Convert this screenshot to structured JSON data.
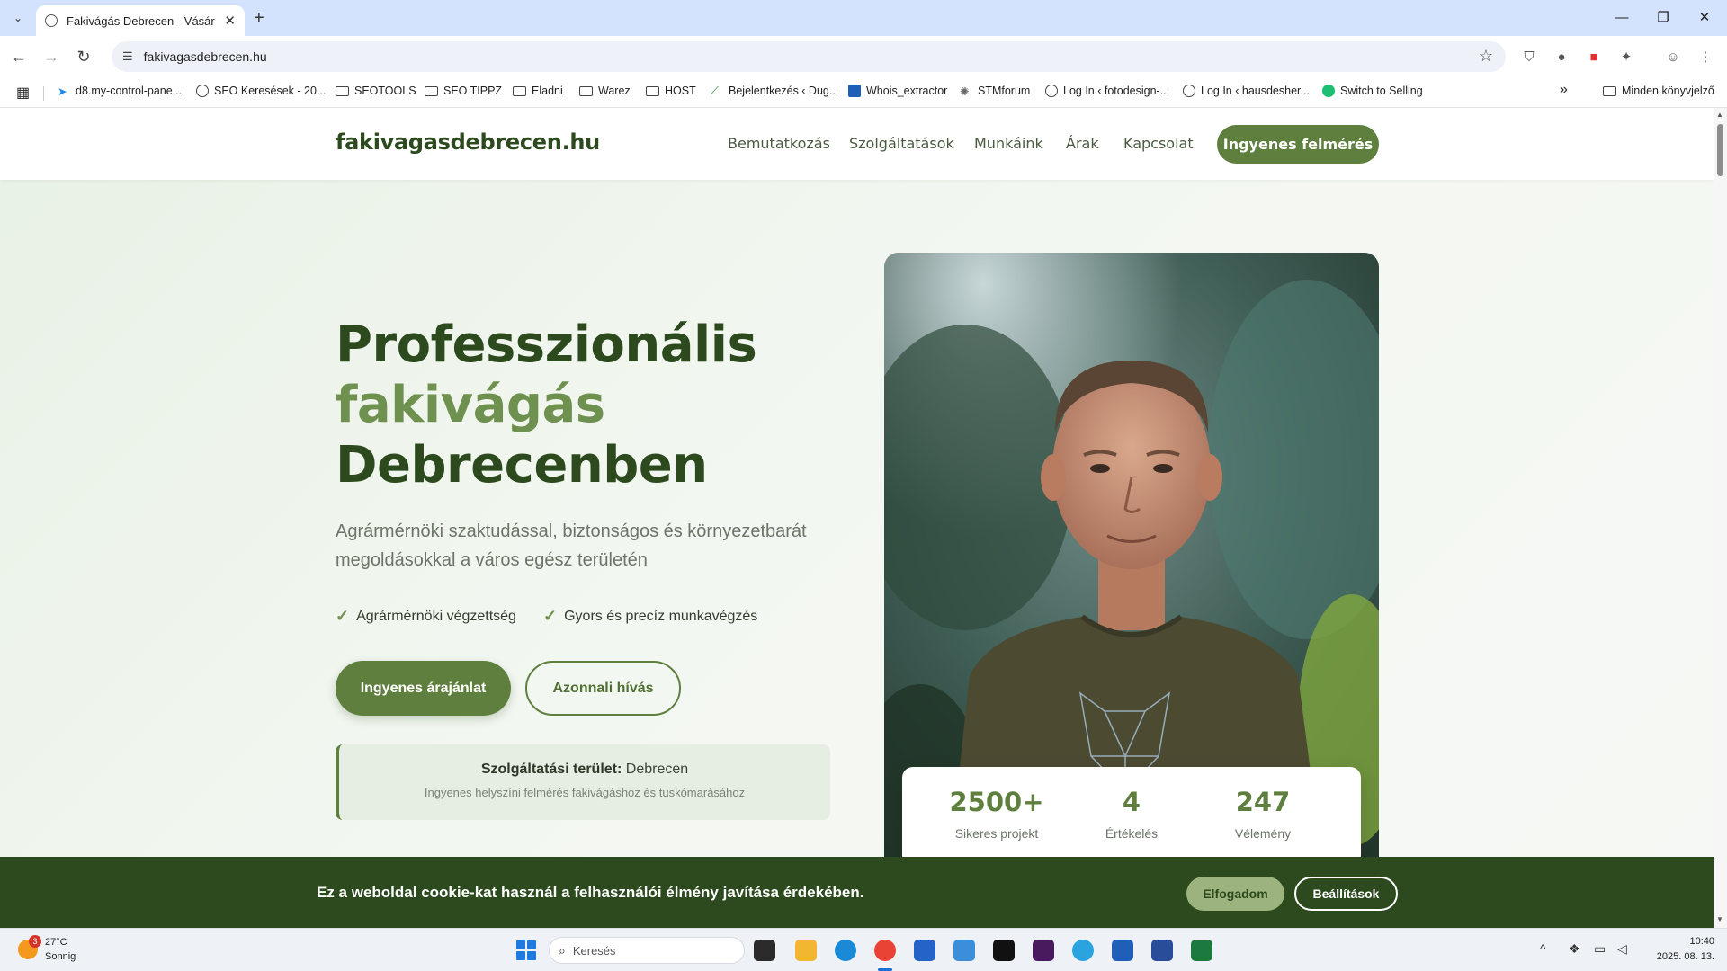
{
  "browser": {
    "tab_title": "Fakivágás Debrecen - Vásári Fe",
    "new_tab_symbol": "+",
    "url": "fakivagasdebrecen.hu",
    "bookmarks": [
      {
        "label": "d8.my-control-pane...",
        "icon": "kinsta-icon"
      },
      {
        "label": "SEO Keresések - 20...",
        "icon": "globe-icon"
      },
      {
        "label": "SEOTOOLS",
        "icon": "folder-icon"
      },
      {
        "label": "SEO TIPPZ",
        "icon": "folder-icon"
      },
      {
        "label": "Eladni",
        "icon": "folder-icon"
      },
      {
        "label": "Warez",
        "icon": "folder-icon"
      },
      {
        "label": "HOST",
        "icon": "folder-icon"
      },
      {
        "label": "Bejelentkezés ‹ Dug...",
        "icon": "site-icon"
      },
      {
        "label": "Whois_extractor",
        "icon": "word-icon"
      },
      {
        "label": "STMforum",
        "icon": "forum-icon"
      },
      {
        "label": "Log In ‹ fotodesign-...",
        "icon": "globe-icon"
      },
      {
        "label": "Log In ‹ hausdesher...",
        "icon": "globe-icon"
      },
      {
        "label": "Switch to Selling",
        "icon": "fiverr-icon"
      }
    ],
    "bookmarks_overflow": "»",
    "all_bookmarks": "Minden könyvjelző"
  },
  "site": {
    "logo": "fakivagasdebrecen.hu",
    "menu": [
      "Bemutatkozás",
      "Szolgáltatások",
      "Munkáink",
      "Árak",
      "Kapcsolat"
    ],
    "cta": "Ingyenes felmérés"
  },
  "hero": {
    "title_line1": "Professzionális",
    "title_line2": "fakivágás",
    "title_line3": "Debrecenben",
    "subtitle": "Agrármérnöki szaktudással, biztonságos és környezetbarát megoldásokkal a város egész területén",
    "features": [
      "Agrármérnöki végzettség",
      "Gyors és precíz munkavégzés"
    ],
    "check_symbol": "✓",
    "primary_button": "Ingyenes árajánlat",
    "secondary_button": "Azonnali hívás",
    "service_area_label": "Szolgáltatási terület:",
    "service_area_value": "Debrecen",
    "service_area_note": "Ingyenes helyszíni felmérés fakivágáshoz és tuskómarásához"
  },
  "stats": [
    {
      "value": "2500+",
      "label": "Sikeres projekt"
    },
    {
      "value": "4",
      "label": "Értékelés"
    },
    {
      "value": "247",
      "label": "Vélemény"
    }
  ],
  "cookie": {
    "text": "Ez a weboldal cookie-kat használ a felhasználói élmény javítása érdekében.",
    "accept": "Elfogadom",
    "settings": "Beállítások"
  },
  "taskbar": {
    "weather_badge": "3",
    "temperature": "27°C",
    "weather": "Sonnig",
    "search_placeholder": "Keresés",
    "time": "10:40",
    "date": "2025. 08. 13."
  },
  "colors": {
    "brand_dark": "#2c4a1e",
    "brand": "#5f7f3f",
    "brand_light": "#6f9150",
    "cookie_accept": "#9cb37d"
  }
}
